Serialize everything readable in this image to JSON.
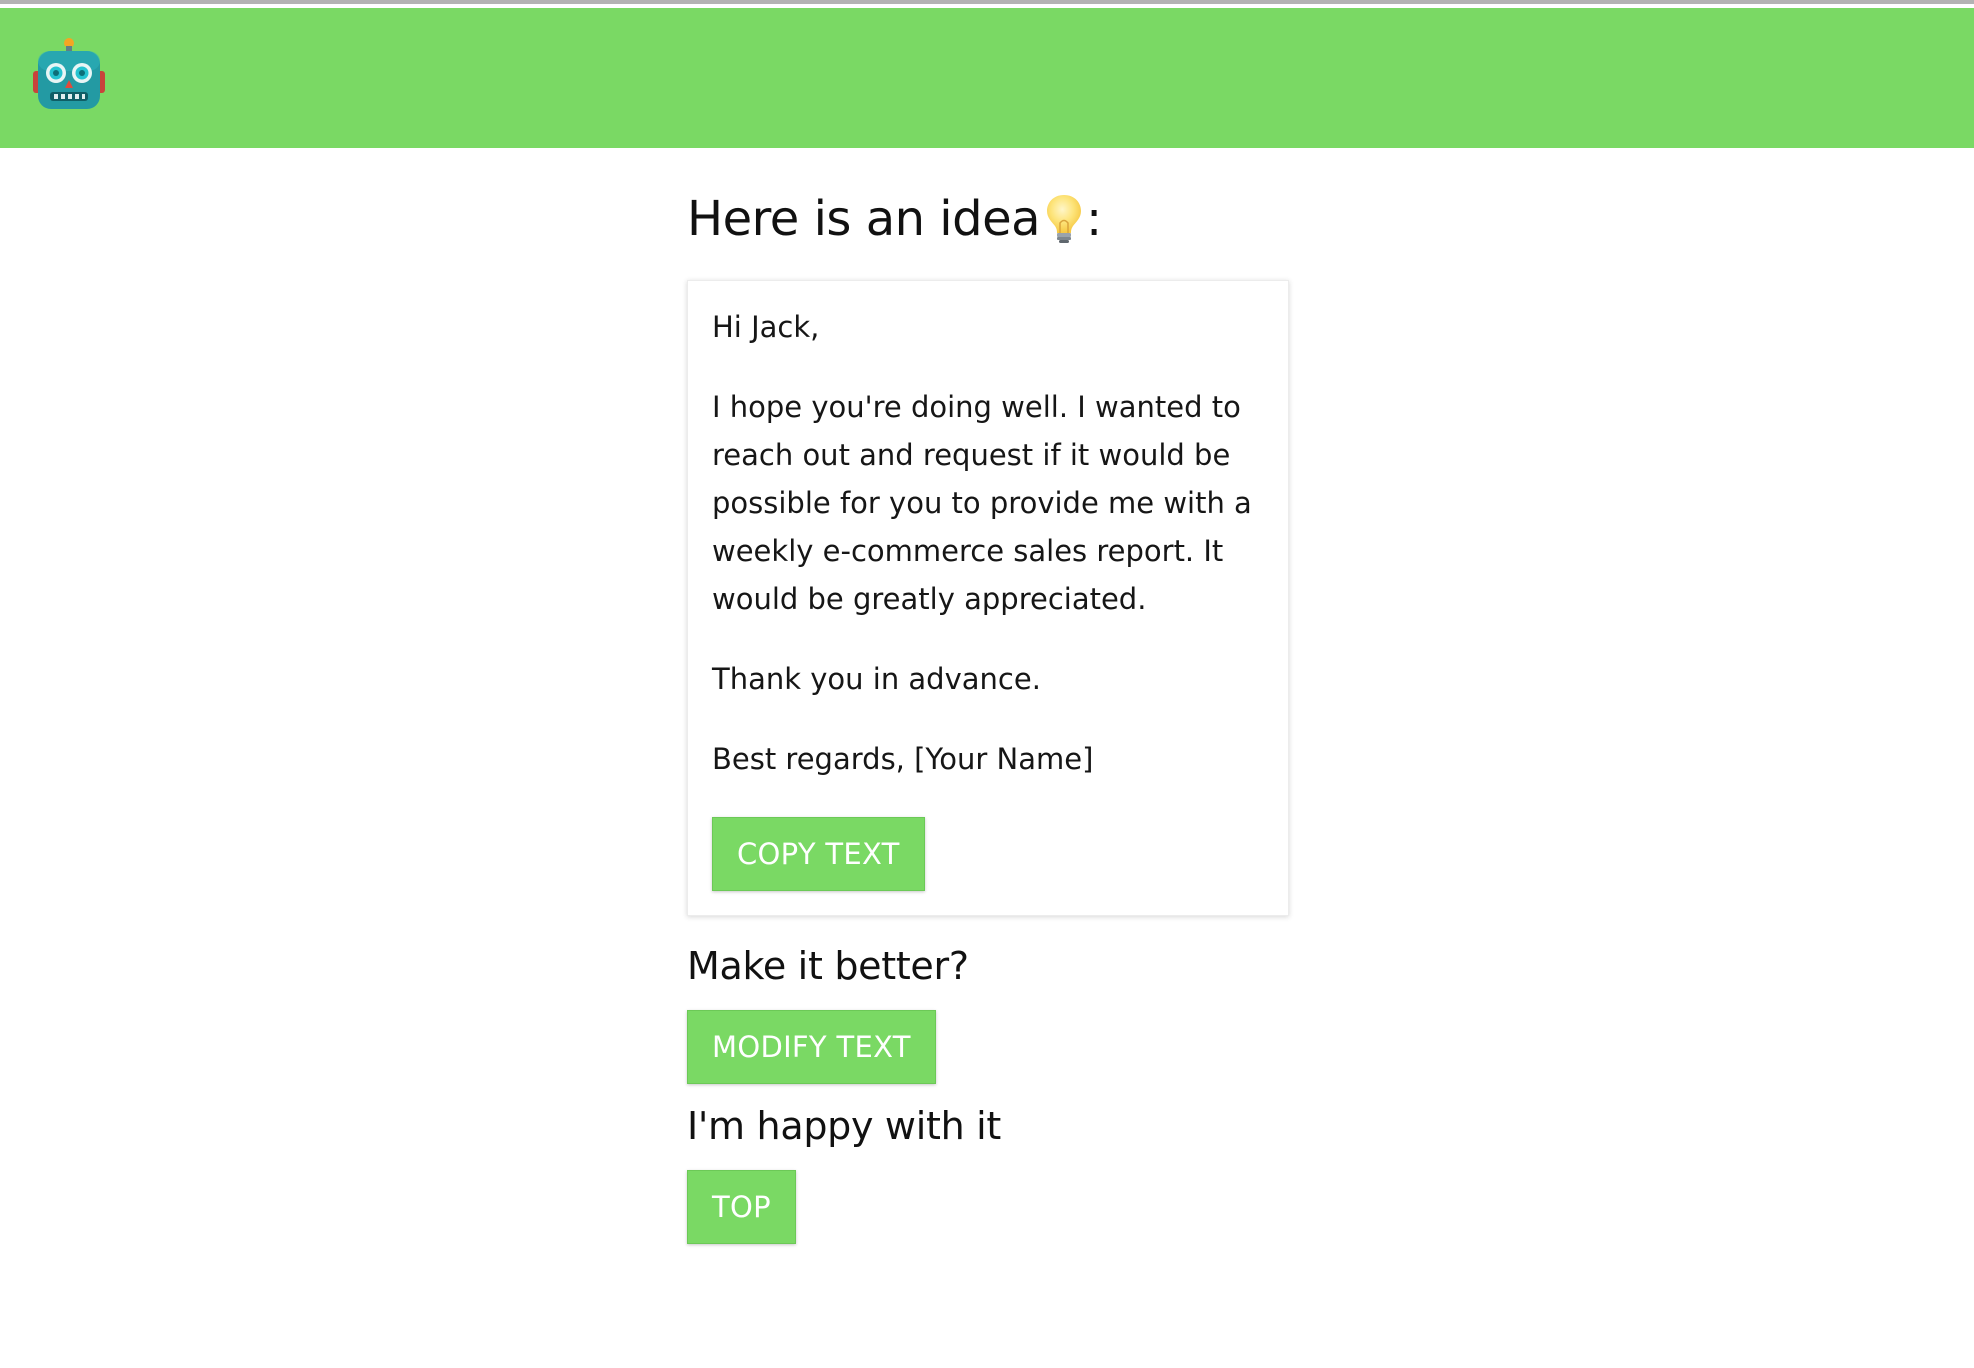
{
  "header": {
    "logo_icon": "robot-icon",
    "background_color": "#7ad964"
  },
  "idea": {
    "heading": "Here is an idea",
    "heading_suffix": ":",
    "heading_icon": "lightbulb-icon"
  },
  "email": {
    "greeting": "Hi Jack,",
    "body": "I hope you're doing well. I wanted to reach out and request if it would be possible for you to provide me with a weekly e-commerce sales report. It would be greatly appreciated.",
    "thanks": "Thank you in advance.",
    "signoff": "Best regards, [Your Name]"
  },
  "buttons": {
    "copy_label": "COPY TEXT",
    "modify_label": "MODIFY TEXT",
    "top_label": "TOP"
  },
  "sections": {
    "improve_prompt": "Make it better?",
    "happy_prompt": "I'm happy with it"
  },
  "colors": {
    "accent": "#7ad964",
    "button_text": "#ffffff"
  }
}
